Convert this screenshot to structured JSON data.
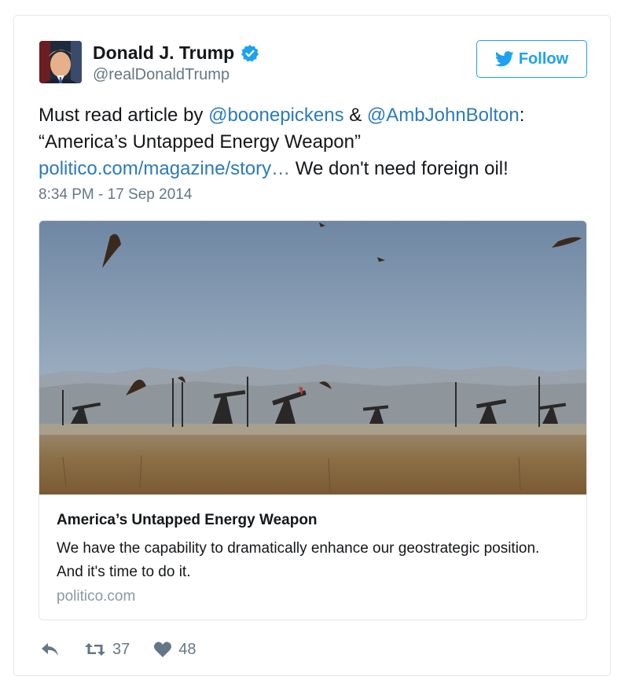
{
  "author": {
    "name": "Donald J. Trump",
    "handle": "@realDonaldTrump",
    "verified": true
  },
  "follow_button": {
    "label": "Follow",
    "icon": "twitter-bird-icon"
  },
  "tweet": {
    "text_part1": "Must read article by ",
    "mention1": "@boonepickens",
    "text_part2": " & ",
    "mention2": "@AmbJohnBolton",
    "text_part3": ":",
    "quote": "“America’s Untapped Energy Weapon”",
    "link": "politico.com/magazine/story…",
    "text_part4": " We don't need foreign oil!",
    "timestamp": "8:34 PM - 17 Sep 2014"
  },
  "card": {
    "image": "oil-field-pumpjacks-with-birds",
    "title": "America’s Untapped Energy Weapon",
    "description": "We have the capability to dramatically enhance our geostrategic position. And it's time to do it.",
    "domain": "politico.com"
  },
  "actions": {
    "reply": {
      "icon": "reply-icon"
    },
    "retweet": {
      "icon": "retweet-icon",
      "count": "37"
    },
    "like": {
      "icon": "heart-icon",
      "count": "48"
    }
  },
  "colors": {
    "link": "#2b7bb9",
    "accent": "#1da1f2",
    "muted": "#657786",
    "border": "#e1e8ed"
  }
}
